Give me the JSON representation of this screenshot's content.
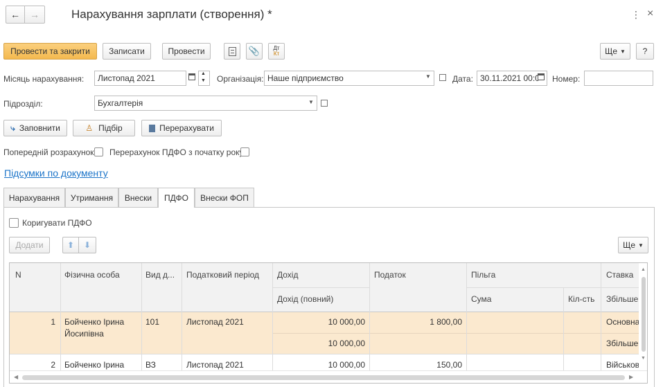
{
  "window": {
    "title": "Нарахування зарплати (створення) *",
    "more_icon": "⋮",
    "close_icon": "×"
  },
  "toolbar": {
    "post_close": "Провести та закрити",
    "save": "Записати",
    "post": "Провести",
    "more": "Ще",
    "help": "?"
  },
  "form": {
    "month_label": "Місяць нарахування:",
    "month_value": "Листопад 2021",
    "org_label": "Організація:",
    "org_value": "Наше підприємство",
    "date_label": "Дата:",
    "date_value": "30.11.2021 00:0",
    "number_label": "Номер:",
    "number_value": "",
    "dept_label": "Підрозділ:",
    "dept_value": "Бухгалтерія"
  },
  "actions": {
    "fill": "Заповнити",
    "pick": "Підбір",
    "recalc": "Перерахувати"
  },
  "options": {
    "preliminary_label": "Попередній розрахунок:",
    "pdfo_recalc_label": "Перерахунок ПДФО з початку року:"
  },
  "summary_link": "Підсумки по документу",
  "tabs": [
    "Нарахування",
    "Утримання",
    "Внески",
    "ПДФО",
    "Внески ФОП"
  ],
  "pdfo": {
    "adjust_label": "Коригувати ПДФО",
    "add": "Додати",
    "more": "Ще"
  },
  "table": {
    "headers": {
      "n": "N",
      "person": "Фізична особа",
      "type": "Вид д...",
      "period": "Податковий період",
      "income": "Дохід",
      "income_full": "Дохід (повний)",
      "tax": "Податок",
      "benefit": "Пільга",
      "benefit_sum": "Сума",
      "benefit_qty": "Кіл-сть",
      "rate": "Ставка",
      "rate_sub": "Збільшен"
    },
    "rows": [
      {
        "n": "1",
        "person": "Бойченко Ірина",
        "person2": "Йосипівна",
        "type": "101",
        "period": "Листопад 2021",
        "income": "10 000,00",
        "income_full": "10 000,00",
        "tax": "1 800,00",
        "rate": "Основна",
        "rate_sub": "Збільшен"
      },
      {
        "n": "2",
        "person": "Бойченко Ірина",
        "type": "ВЗ",
        "period": "Листопад 2021",
        "income": "10 000,00",
        "tax": "150,00",
        "rate": "Військові"
      }
    ]
  },
  "colors": {
    "primary_button": "#f4b94f",
    "selected_row": "#fbe9cf",
    "link": "#1a73c8"
  }
}
